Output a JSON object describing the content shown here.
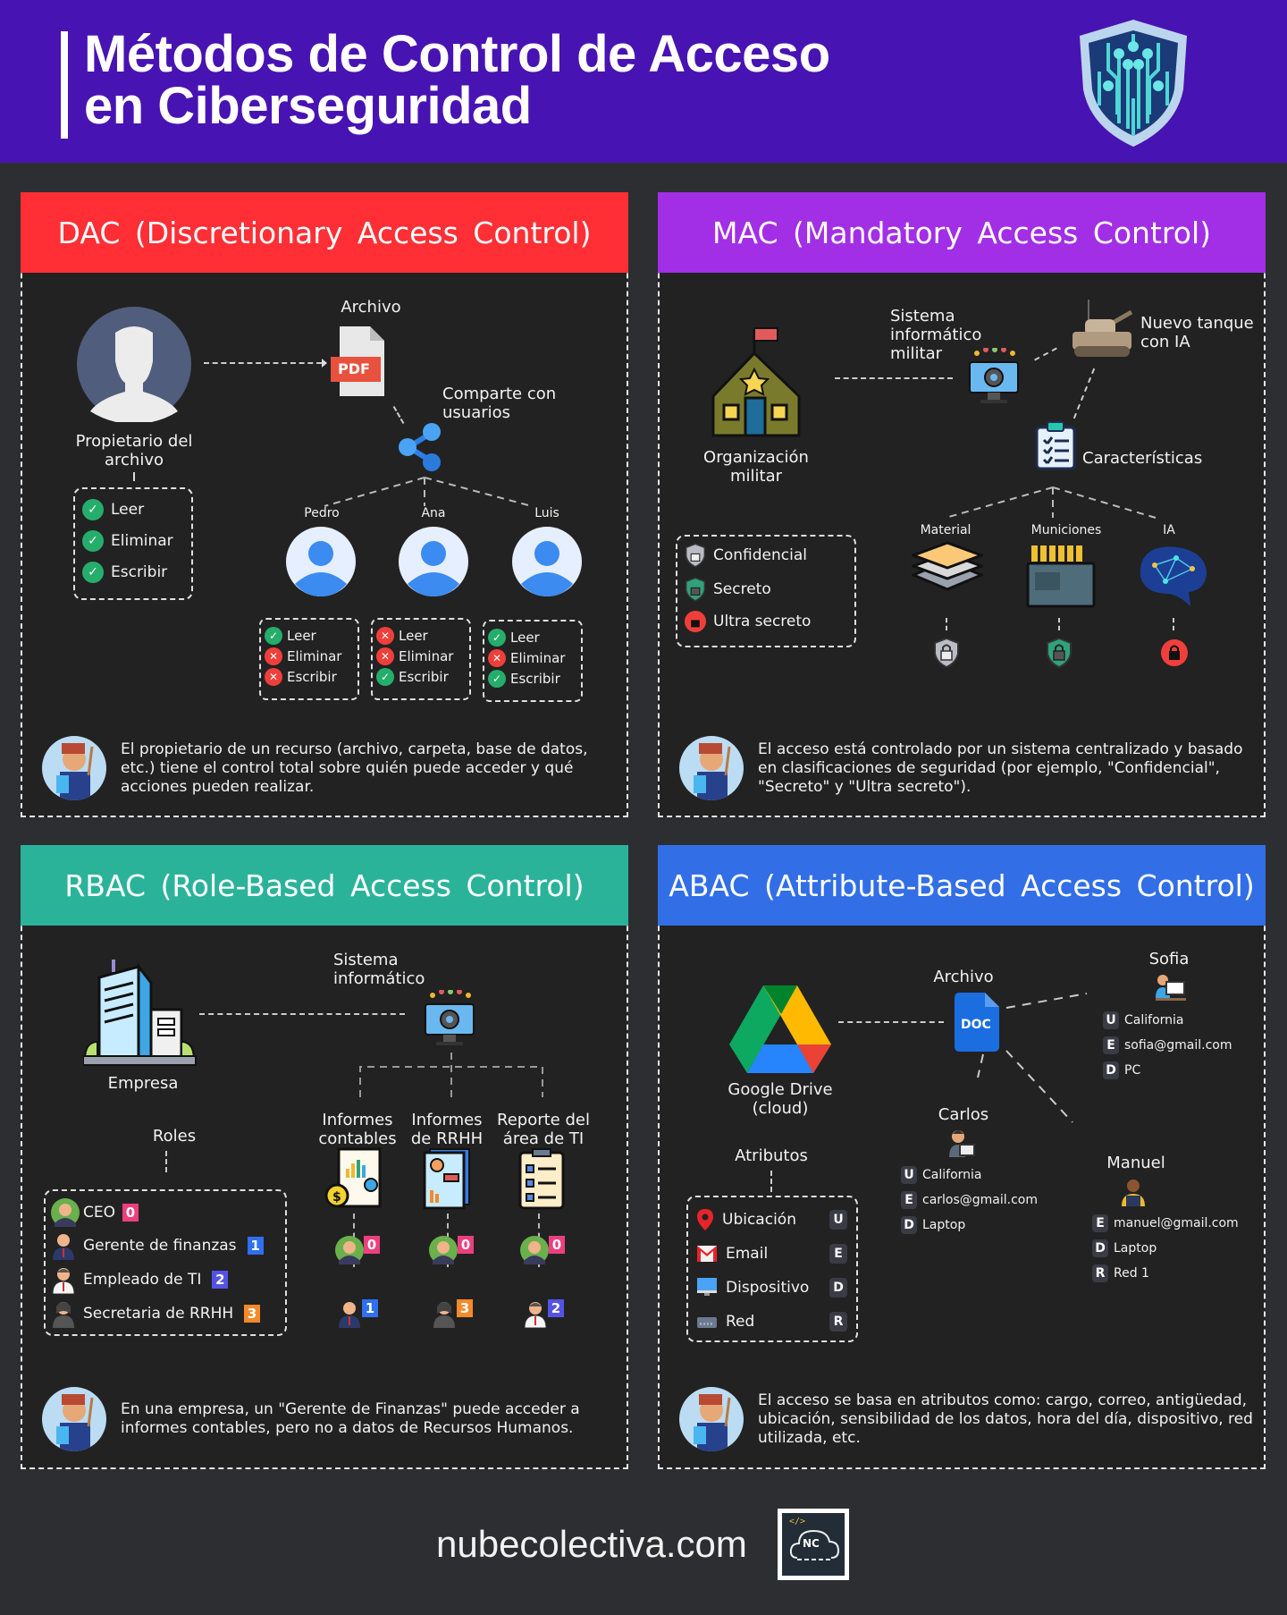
{
  "header": {
    "title_line1": "Métodos de Control de Acceso",
    "title_line2": "en Ciberseguridad",
    "icon": "circuit-shield-icon",
    "color": "#4813b3"
  },
  "dac": {
    "title": "DAC (Discretionary Access Control)",
    "color": "#ff2f35",
    "owner_label": "Propietario del archivo",
    "file_label": "Archivo",
    "file_type": "PDF",
    "share_label": "Comparte con usuarios",
    "owner_permissions": [
      {
        "label": "Leer",
        "allowed": true
      },
      {
        "label": "Eliminar",
        "allowed": true
      },
      {
        "label": "Escribir",
        "allowed": true
      }
    ],
    "users": [
      {
        "name": "Pedro",
        "permissions": [
          {
            "label": "Leer",
            "allowed": true
          },
          {
            "label": "Eliminar",
            "allowed": false
          },
          {
            "label": "Escribir",
            "allowed": false
          }
        ]
      },
      {
        "name": "Ana",
        "permissions": [
          {
            "label": "Leer",
            "allowed": false
          },
          {
            "label": "Eliminar",
            "allowed": false
          },
          {
            "label": "Escribir",
            "allowed": true
          }
        ]
      },
      {
        "name": "Luis",
        "permissions": [
          {
            "label": "Leer",
            "allowed": true
          },
          {
            "label": "Eliminar",
            "allowed": false
          },
          {
            "label": "Escribir",
            "allowed": true
          }
        ]
      }
    ],
    "note": "El propietario de un recurso (archivo, carpeta, base de datos, etc.) tiene el control total sobre quién puede acceder y qué acciones pueden realizar."
  },
  "mac": {
    "title": "MAC (Mandatory Access Control)",
    "color": "#a22ee6",
    "org_label": "Organización militar",
    "system_label": "Sistema informático militar",
    "tank_label": "Nuevo tanque con IA",
    "features_label": "Características",
    "levels": [
      {
        "label": "Confidencial",
        "icon": "gray-shield-lock-icon"
      },
      {
        "label": "Secreto",
        "icon": "green-shield-lock-icon"
      },
      {
        "label": "Ultra secreto",
        "icon": "red-lock-icon"
      }
    ],
    "items": [
      {
        "label": "Material",
        "level": "Confidencial"
      },
      {
        "label": "Municiones",
        "level": "Secreto"
      },
      {
        "label": "IA",
        "level": "Ultra secreto"
      }
    ],
    "note": "El acceso está controlado por un sistema centralizado y basado en clasificaciones de seguridad (por ejemplo, \"Confidencial\", \"Secreto\" y \"Ultra secreto\")."
  },
  "rbac": {
    "title": "RBAC (Role-Based Access Control)",
    "color": "#2bb39a",
    "company_label": "Empresa",
    "system_label": "Sistema informático",
    "roles_label": "Roles",
    "roles": [
      {
        "label": "CEO",
        "num": "0",
        "color": "#ec3f7f"
      },
      {
        "label": "Gerente de finanzas",
        "num": "1",
        "color": "#2f6ff0"
      },
      {
        "label": "Empleado de TI",
        "num": "2",
        "color": "#5553e6"
      },
      {
        "label": "Secretaria de RRHH",
        "num": "3",
        "color": "#f48a2a"
      }
    ],
    "resources": [
      {
        "label": "Informes contables",
        "roles": [
          "0",
          "1"
        ]
      },
      {
        "label": "Informes de RRHH",
        "roles": [
          "0",
          "3"
        ]
      },
      {
        "label": "Reporte del área de TI",
        "roles": [
          "0",
          "2"
        ]
      }
    ],
    "note": "En una empresa, un \"Gerente de Finanzas\" puede acceder a informes contables, pero no a datos de Recursos Humanos."
  },
  "abac": {
    "title": "ABAC (Attribute-Based Access Control)",
    "color": "#326ee6",
    "cloud_label": "Google Drive (cloud)",
    "file_label": "Archivo",
    "file_type": "DOC",
    "attributes_label": "Atributos",
    "attributes": [
      {
        "label": "Ubicación",
        "key": "U"
      },
      {
        "label": "Email",
        "key": "E"
      },
      {
        "label": "Dispositivo",
        "key": "D"
      },
      {
        "label": "Red",
        "key": "R"
      }
    ],
    "users": [
      {
        "name": "Sofia",
        "attrs": [
          {
            "key": "U",
            "value": "California"
          },
          {
            "key": "E",
            "value": "sofia@gmail.com"
          },
          {
            "key": "D",
            "value": "PC"
          }
        ]
      },
      {
        "name": "Carlos",
        "attrs": [
          {
            "key": "U",
            "value": "California"
          },
          {
            "key": "E",
            "value": "carlos@gmail.com"
          },
          {
            "key": "D",
            "value": "Laptop"
          }
        ]
      },
      {
        "name": "Manuel",
        "attrs": [
          {
            "key": "E",
            "value": "manuel@gmail.com"
          },
          {
            "key": "D",
            "value": "Laptop"
          },
          {
            "key": "R",
            "value": "Red 1"
          }
        ]
      }
    ],
    "note": "El acceso se basa en atributos como: cargo, correo, antigüedad, ubicación, sensibilidad de los datos, hora del día, dispositivo, red utilizada, etc."
  },
  "footer": {
    "site": "nubecolectiva.com",
    "logo_text": "NC",
    "logo_code": "</>"
  }
}
